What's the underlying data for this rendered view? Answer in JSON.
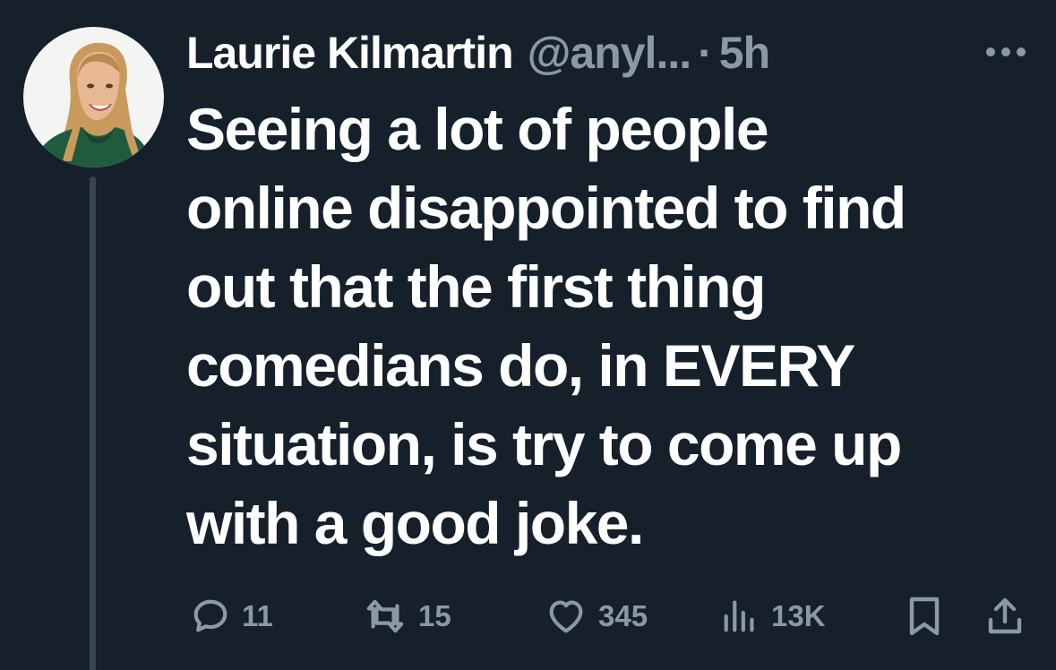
{
  "tweet": {
    "author_name": "Laurie Kilmartin",
    "handle": "@anyl...",
    "separator": "·",
    "time": "5h",
    "text_lines": [
      "Seeing a lot of people",
      "online disappointed to find",
      "out that the first thing",
      "comedians do, in EVERY",
      "situation, is try to come up",
      "with a good joke."
    ]
  },
  "actions": {
    "replies": "11",
    "retweets": "15",
    "likes": "345",
    "views": "13K"
  },
  "icons": {
    "more": "more-horizontal-icon",
    "reply": "reply-bubble-icon",
    "retweet": "retweet-icon",
    "like": "heart-icon",
    "views": "views-chart-icon",
    "bookmark": "bookmark-icon",
    "share": "share-icon"
  },
  "colors": {
    "background": "#15202b",
    "primary_text": "#ffffff",
    "secondary_text": "#8b98a5",
    "thread_line": "#38444d"
  }
}
